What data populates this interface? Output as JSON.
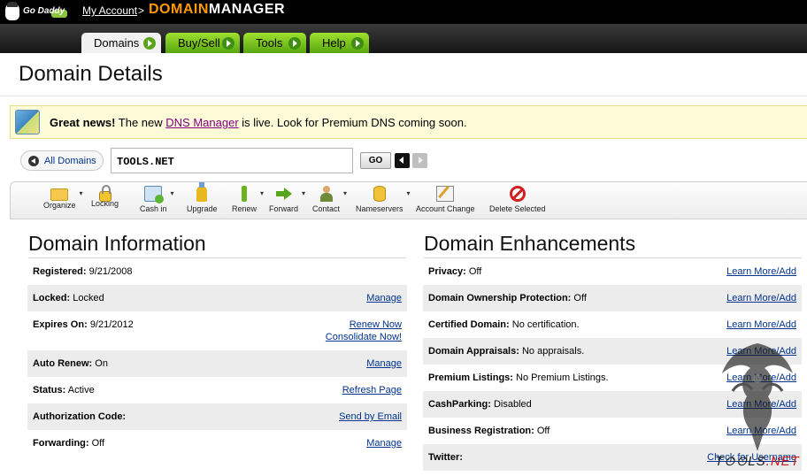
{
  "header": {
    "logo_text": "Go Daddy",
    "my_account": "My Account",
    "separator": ">",
    "app_title_a": "DOMAIN",
    "app_title_b": "MANAGER"
  },
  "nav": {
    "tabs": [
      {
        "label": "Domains",
        "active": true
      },
      {
        "label": "Buy/Sell",
        "active": false
      },
      {
        "label": "Tools",
        "active": false
      },
      {
        "label": "Help",
        "active": false
      }
    ]
  },
  "page": {
    "title": "Domain Details"
  },
  "banner": {
    "lead": "Great news!",
    "pre": " The new ",
    "link": "DNS Manager",
    "post": " is live. Look for Premium DNS coming soon."
  },
  "search": {
    "all_domains": "All Domains",
    "domain": "TOOLS.NET",
    "go": "GO"
  },
  "toolbar": {
    "items": [
      {
        "label": "Organize",
        "icon": "folder-icon",
        "caret": true
      },
      {
        "label": "Locking",
        "icon": "lock-icon",
        "caret": false
      },
      {
        "label": "Cash in",
        "icon": "cash-icon",
        "caret": true
      },
      {
        "label": "Upgrade",
        "icon": "upgrade-icon",
        "caret": false
      },
      {
        "label": "Renew",
        "icon": "renew-icon",
        "caret": true
      },
      {
        "label": "Forward",
        "icon": "forward-arrow-icon",
        "caret": true
      },
      {
        "label": "Contact",
        "icon": "contact-icon",
        "caret": true
      },
      {
        "label": "Nameservers",
        "icon": "nameservers-icon",
        "caret": true
      },
      {
        "label": "Account Change",
        "icon": "account-change-icon",
        "caret": false
      },
      {
        "label": "Delete Selected",
        "icon": "delete-icon",
        "caret": false
      }
    ]
  },
  "domain_info": {
    "title": "Domain Information",
    "rows": [
      {
        "label": "Registered:",
        "value": "9/21/2008",
        "link": ""
      },
      {
        "label": "Locked:",
        "value": "Locked",
        "link": "Manage"
      },
      {
        "label": "Expires On:",
        "value": "9/21/2012",
        "link": "Renew Now",
        "link2": "Consolidate Now!"
      },
      {
        "label": "Auto Renew:",
        "value": "On",
        "link": "Manage"
      },
      {
        "label": "Status:",
        "value": "Active",
        "link": "Refresh Page"
      },
      {
        "label": "Authorization Code:",
        "value": "",
        "link": "Send by Email"
      },
      {
        "label": "Forwarding:",
        "value": "Off",
        "link": "Manage"
      }
    ]
  },
  "enhancements": {
    "title": "Domain Enhancements",
    "rows": [
      {
        "label": "Privacy:",
        "value": "Off",
        "link": "Learn More/Add"
      },
      {
        "label": "Domain Ownership Protection:",
        "value": "Off",
        "link": "Learn More/Add"
      },
      {
        "label": "Certified Domain:",
        "value": "No certification.",
        "link": "Learn More/Add"
      },
      {
        "label": "Domain Appraisals:",
        "value": "No appraisals.",
        "link": "Learn More/Add"
      },
      {
        "label": "Premium Listings:",
        "value": "No Premium Listings.",
        "link": "Learn More/Add"
      },
      {
        "label": "CashParking:",
        "value": "Disabled",
        "link": "Learn More/Add"
      },
      {
        "label": "Business Registration:",
        "value": "Off",
        "link": "Learn More/Add"
      },
      {
        "label": "Twitter:",
        "value": "",
        "link": "Check for Username"
      }
    ]
  },
  "watermark": {
    "a": "T⊙⊙LS",
    "b": ".NET"
  },
  "colors": {
    "accent_orange": "#ff9900",
    "tab_green": "#7cc41f",
    "link_blue": "#00338f",
    "banner_bg": "#fefcd8"
  }
}
